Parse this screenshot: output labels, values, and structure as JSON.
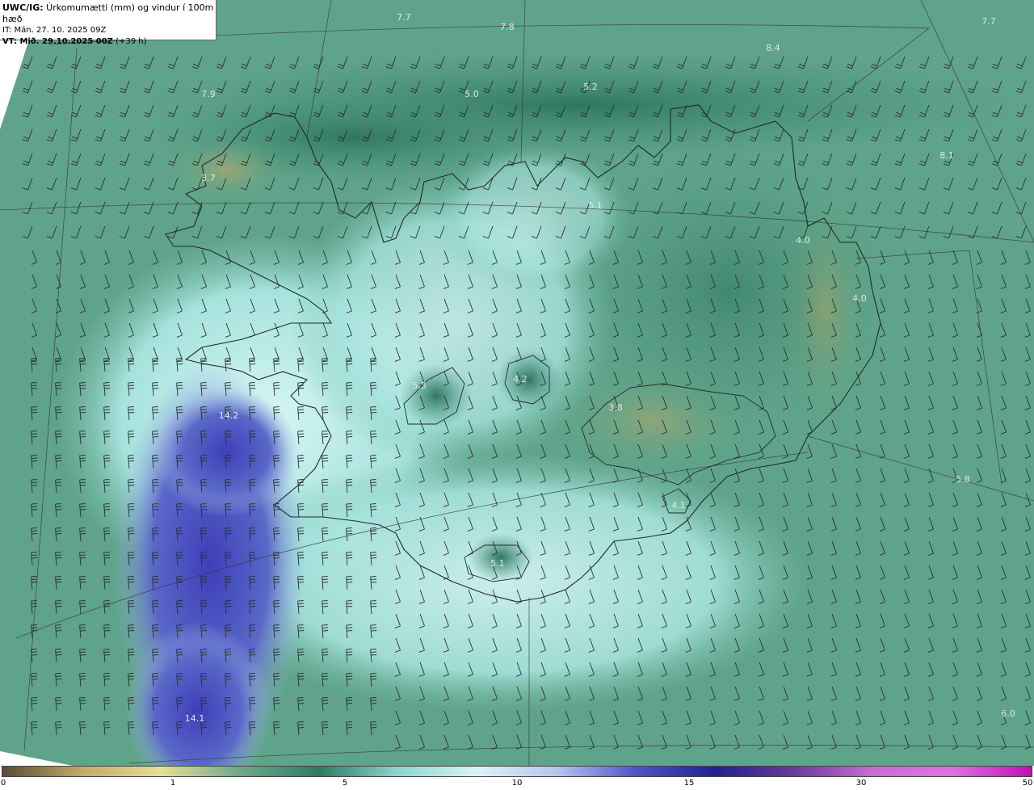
{
  "header": {
    "title_bold": "UWC/IG:",
    "title_rest": " Úrkomumætti (mm) og vindur í 100m hæð",
    "it_line": "IT: Mán. 27. 10. 2025 09Z",
    "vt_bold": "VT: Mið. 29.10.2025 00Z",
    "vt_rest": " (+39 h)"
  },
  "map_labels": [
    {
      "text": "7.7"
    },
    {
      "text": "7.8"
    },
    {
      "text": "8.4"
    },
    {
      "text": "7.7"
    },
    {
      "text": "7.9"
    },
    {
      "text": "5.0"
    },
    {
      "text": "5.2"
    },
    {
      "text": "8.1"
    },
    {
      "text": "3.7"
    },
    {
      "text": "5.1"
    },
    {
      "text": "4.0"
    },
    {
      "text": "4.0"
    },
    {
      "text": "5.3"
    },
    {
      "text": "4.2"
    },
    {
      "text": "3.8"
    },
    {
      "text": "14.2"
    },
    {
      "text": "5.8"
    },
    {
      "text": "4.1"
    },
    {
      "text": "5.1"
    },
    {
      "text": "6.0"
    },
    {
      "text": "14.1"
    }
  ],
  "colorbar": {
    "ticks": [
      "0",
      "1",
      "5",
      "10",
      "15",
      "30",
      "50"
    ],
    "colors": [
      "#5a4a38",
      "#c2a96a",
      "#e8df95",
      "#6fa88a",
      "#2f7a63",
      "#8fd6d0",
      "#d9f4f6",
      "#b8c6ee",
      "#4f55c8",
      "#222090",
      "#6a3a9a",
      "#c86ed2",
      "#e070e0",
      "#c010b8"
    ]
  }
}
